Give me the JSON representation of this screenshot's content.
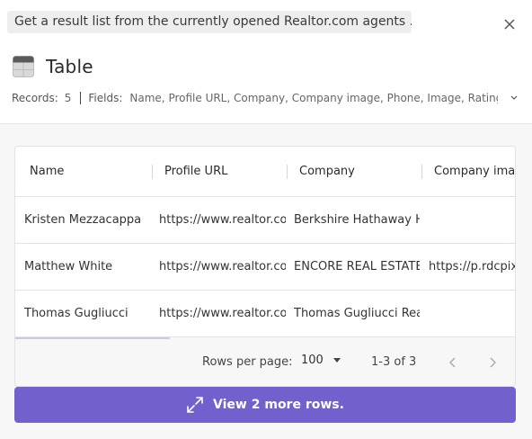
{
  "header": {
    "prompt": "Get a result list from the currently opened Realtor.com agents ..."
  },
  "title": {
    "label": "Table",
    "icon": "table-icon"
  },
  "meta": {
    "records_label": "Records:",
    "records_value": "5",
    "fields_label": "Fields:",
    "fields_value": "Name, Profile URL, Company, Company image, Phone, Image, Rating..."
  },
  "table": {
    "columns": [
      "Name",
      "Profile URL",
      "Company",
      "Company ima..."
    ],
    "rows": [
      [
        "Kristen Mezzacappa",
        "https://www.realtor.com",
        "Berkshire Hathaway Ho",
        ""
      ],
      [
        "Matthew White",
        "https://www.realtor.com",
        "ENCORE REAL ESTATE",
        "https://p.rdcpix."
      ],
      [
        "Thomas Gugliucci",
        "https://www.realtor.com",
        "Thomas Gugliucci Real",
        ""
      ]
    ]
  },
  "pagination": {
    "rows_per_page_label": "Rows per page:",
    "rows_per_page_value": "100",
    "range": "1-3 of 3"
  },
  "more_button": {
    "label": "View 2 more rows."
  },
  "colors": {
    "accent": "#7260cd",
    "pill_bg": "#eeeeee",
    "panel_bg": "#f7f7f8"
  }
}
